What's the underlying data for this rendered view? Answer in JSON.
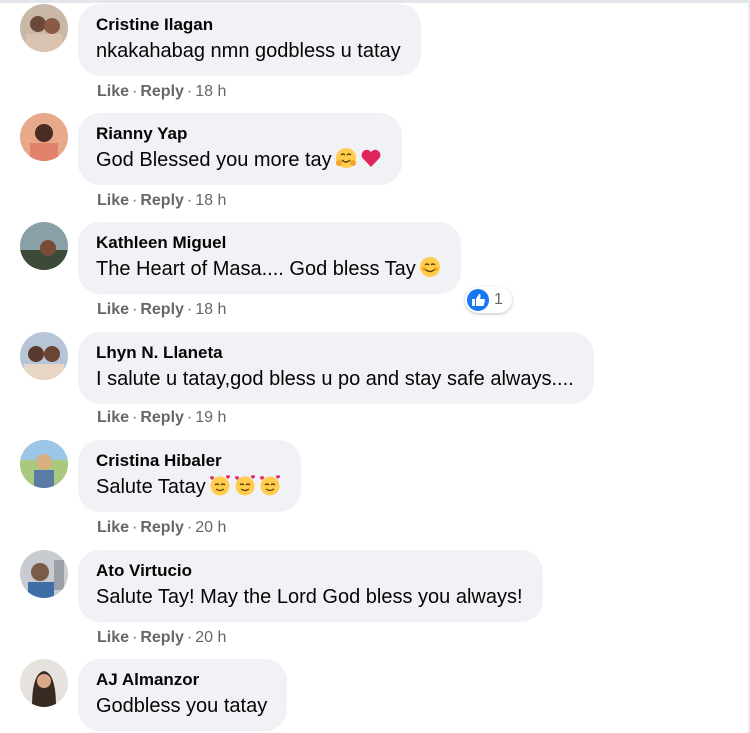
{
  "comments": [
    {
      "name": "Cristine Ilagan",
      "text": "nkakahabag nmn godbless u tatay",
      "like_label": "Like",
      "reply_label": "Reply",
      "time": "18 h"
    },
    {
      "name": "Rianny Yap",
      "text": "God Blessed you more tay",
      "emojis": [
        "hugging-face-icon",
        "red-heart-icon"
      ],
      "like_label": "Like",
      "reply_label": "Reply",
      "time": "18 h"
    },
    {
      "name": "Kathleen Miguel",
      "text": "The Heart of Masa.... God bless Tay",
      "emojis": [
        "smiling-face-icon"
      ],
      "like_label": "Like",
      "reply_label": "Reply",
      "time": "18 h",
      "reaction": {
        "icon": "like-icon",
        "count": "1"
      }
    },
    {
      "name": "Lhyn N. Llaneta",
      "text": "I salute u tatay,god bless u po and stay safe always....",
      "like_label": "Like",
      "reply_label": "Reply",
      "time": "19 h"
    },
    {
      "name": "Cristina Hibaler",
      "text": "Salute Tatay",
      "emojis": [
        "smiling-face-with-hearts-icon",
        "smiling-face-with-hearts-icon",
        "smiling-face-with-hearts-icon"
      ],
      "like_label": "Like",
      "reply_label": "Reply",
      "time": "20 h"
    },
    {
      "name": "Ato Virtucio",
      "text": "Salute Tay! May the Lord God bless you always!",
      "like_label": "Like",
      "reply_label": "Reply",
      "time": "20 h"
    },
    {
      "name": "AJ Almanzor",
      "text": "Godbless you tatay"
    }
  ],
  "colors": {
    "bubble": "#f0f2f5",
    "meta_text": "#65676b",
    "like_blue": "#1877f2",
    "heart_red": "#e0245e"
  }
}
